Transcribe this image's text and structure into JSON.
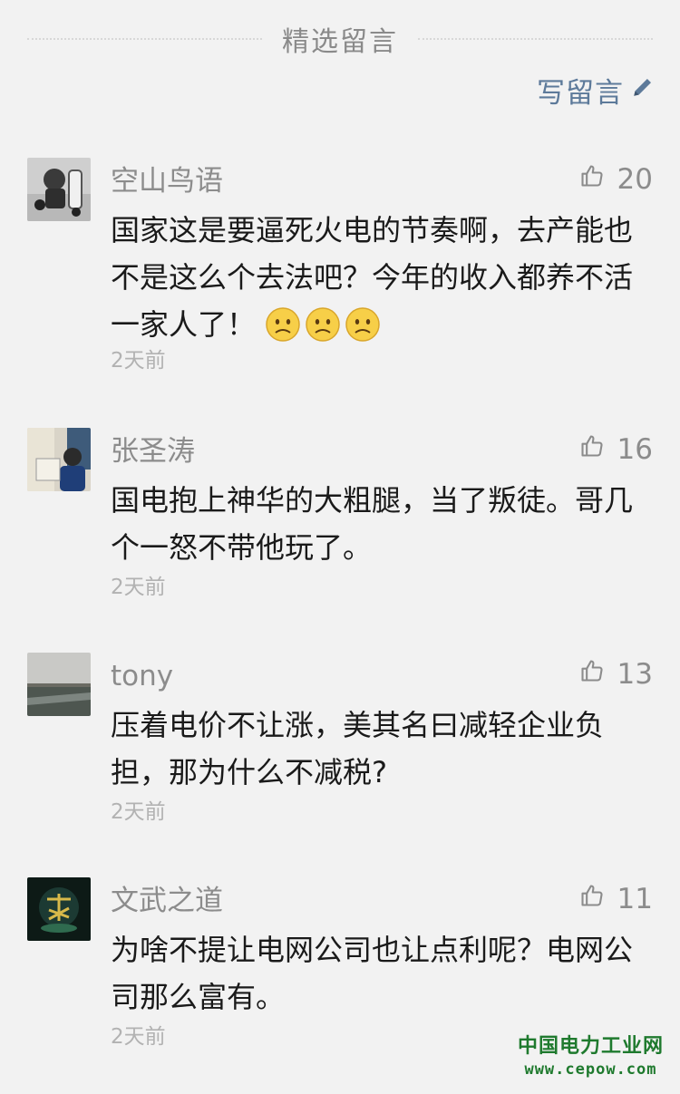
{
  "header": {
    "title": "精选留言",
    "write_label": "写留言"
  },
  "comments": [
    {
      "nickname": "空山鸟语",
      "likes": "20",
      "content": "国家这是要逼死火电的节奏啊，去产能也不是这么个去法吧？今年的收入都养不活一家人了！",
      "time": "2天前",
      "avatar_icon": "child-photo-avatar"
    },
    {
      "nickname": "张圣涛",
      "likes": "16",
      "content": "国电抱上神华的大粗腿，当了叛徒。哥几个一怒不带他玩了。",
      "time": "2天前",
      "avatar_icon": "child-reading-photo-avatar"
    },
    {
      "nickname": "tony",
      "likes": "13",
      "content": "压着电价不让涨，美其名曰减轻企业负担，那为什么不减税?",
      "time": "2天前",
      "avatar_icon": "landscape-photo-avatar"
    },
    {
      "nickname": "文武之道",
      "likes": "11",
      "content": "为啥不提让电网公司也让点利呢？电网公司那么富有。",
      "time": "2天前",
      "avatar_icon": "calligraphy-logo-avatar"
    }
  ],
  "watermark": {
    "cn": "中国电力工业网",
    "en": "www.cepow.com"
  },
  "colors": {
    "background": "#f2f2f2",
    "link": "#5d7a9a",
    "meta": "#8c8c8c",
    "text": "#1a1a1a",
    "watermark": "#1f7a2e"
  }
}
